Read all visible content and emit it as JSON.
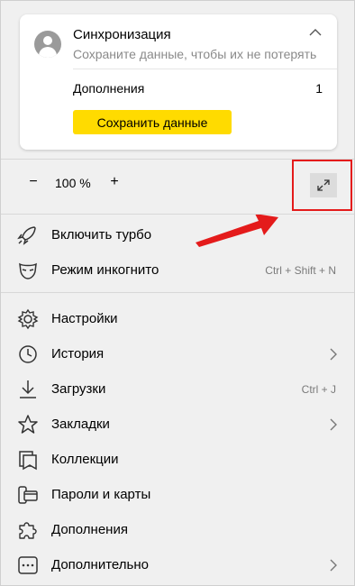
{
  "sync": {
    "title": "Синхронизация",
    "subtitle": "Сохраните данные, чтобы их не потерять",
    "addons_label": "Дополнения",
    "addons_count": "1",
    "save_button": "Сохранить данные"
  },
  "zoom": {
    "minus": "−",
    "value": "100 %",
    "plus": "+"
  },
  "menu": [
    {
      "label": "Включить турбо",
      "icon": "rocket-icon"
    },
    {
      "label": "Режим инкогнито",
      "icon": "incognito-mask-icon",
      "shortcut": "Ctrl + Shift + N"
    },
    {
      "label": "Настройки",
      "icon": "gear-icon"
    },
    {
      "label": "История",
      "icon": "clock-icon"
    },
    {
      "label": "Загрузки",
      "icon": "download-icon",
      "shortcut": "Ctrl + J"
    },
    {
      "label": "Закладки",
      "icon": "star-icon"
    },
    {
      "label": "Коллекции",
      "icon": "collections-icon"
    },
    {
      "label": "Пароли и карты",
      "icon": "key-card-icon"
    },
    {
      "label": "Дополнения",
      "icon": "puzzle-icon"
    },
    {
      "label": "Дополнительно",
      "icon": "more-icon"
    }
  ],
  "colors": {
    "accent_button": "#ffdb00",
    "highlight": "#e41b1b"
  }
}
